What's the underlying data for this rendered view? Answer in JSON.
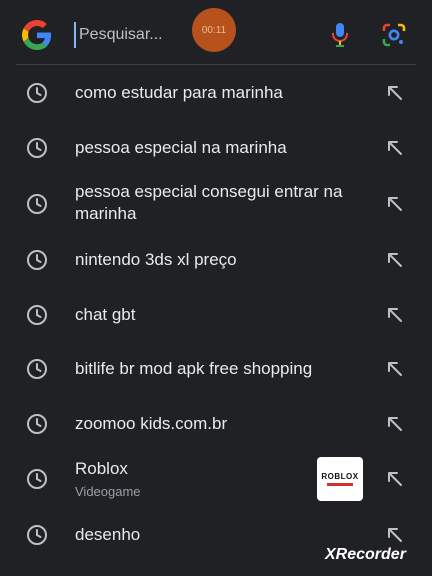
{
  "search": {
    "placeholder": "Pesquisar...",
    "recording_timer": "00:11"
  },
  "suggestions": [
    {
      "text": "como estudar para marinha"
    },
    {
      "text": "pessoa especial na marinha"
    },
    {
      "text": "pessoa especial consegui entrar na marinha"
    },
    {
      "text": "nintendo 3ds xl preço"
    },
    {
      "text": "chat gbt"
    },
    {
      "text": "bitlife br mod apk free shopping"
    },
    {
      "text": "zoomoo kids.com.br"
    },
    {
      "text": "Roblox",
      "subtitle": "Videogame",
      "thumbnail_text": "ROBLOX"
    },
    {
      "text": "desenho"
    }
  ],
  "watermark": "XRecorder",
  "icons": {
    "logo": "google-g-icon",
    "mic": "microphone-icon",
    "lens": "google-lens-icon",
    "history": "history-clock-icon",
    "fill": "arrow-up-left-icon"
  },
  "colors": {
    "background": "#202124",
    "text": "#e8eaed",
    "subtext": "#9aa0a6",
    "recorder": "#c1551c"
  }
}
